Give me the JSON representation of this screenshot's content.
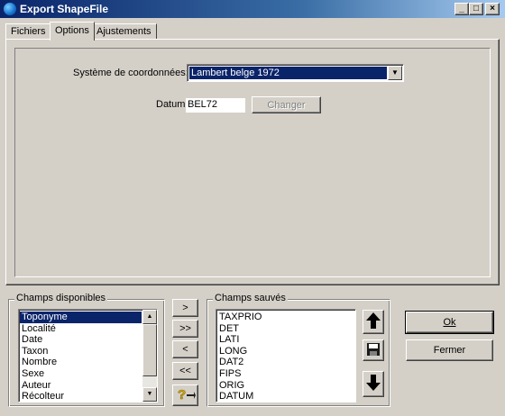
{
  "window": {
    "title": "Export ShapeFile",
    "minimize": "_",
    "maximize": "□",
    "close": "×"
  },
  "tabs": [
    {
      "label": "Fichiers"
    },
    {
      "label": "Options"
    },
    {
      "label": "Ajustements"
    }
  ],
  "options": {
    "coord_label": "Système de coordonnées:",
    "coord_value": "Lambert belge 1972",
    "datum_label": "Datum:",
    "datum_value": "BEL72",
    "changer_label": "Changer"
  },
  "available_fields": {
    "caption": "Champs disponibles",
    "items": [
      "Toponyme",
      "Localité",
      "Date",
      "Taxon",
      "Nombre",
      "Sexe",
      "Auteur",
      "Récolteur"
    ],
    "selected_index": 0
  },
  "transfer_buttons": {
    "add": ">",
    "add_all": ">>",
    "remove": "<",
    "remove_all": "<<"
  },
  "saved_fields": {
    "caption": "Champs sauvés",
    "items": [
      "TAXPRIO",
      "DET",
      "LATI",
      "LONG",
      "DAT2",
      "FIPS",
      "ORIG",
      "DATUM"
    ]
  },
  "dialog_buttons": {
    "ok": "Ok",
    "close": "Fermer"
  },
  "icons": {
    "up": "arrow-up-icon",
    "save": "save-icon",
    "down": "arrow-down-icon",
    "help": "help-icon"
  },
  "colors": {
    "title_start": "#0a246a",
    "title_end": "#a6caf0",
    "selection": "#0a246a",
    "face": "#d4d0c8"
  }
}
